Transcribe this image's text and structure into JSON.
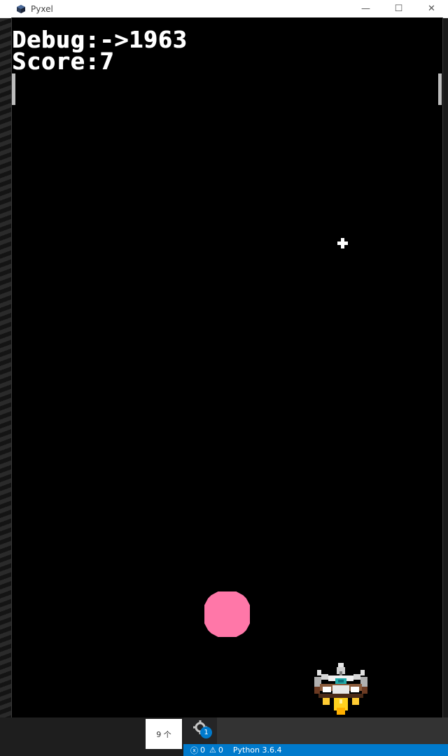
{
  "window": {
    "title": "Pyxel",
    "controls": {
      "minimize": "—",
      "maximize": "☐",
      "close": "✕"
    }
  },
  "game": {
    "debug_text": "Debug:->1963",
    "score_text": "Score:7",
    "colors": {
      "background": "#000000",
      "ball": "#ff77a8",
      "hud": "#ffffff"
    }
  },
  "taskbar": {
    "popup_text": "9 个"
  },
  "ide": {
    "gear_badge": "1",
    "errors": "0",
    "warnings": "0",
    "interpreter": "Python 3.6.4",
    "accent": "#007acc"
  }
}
